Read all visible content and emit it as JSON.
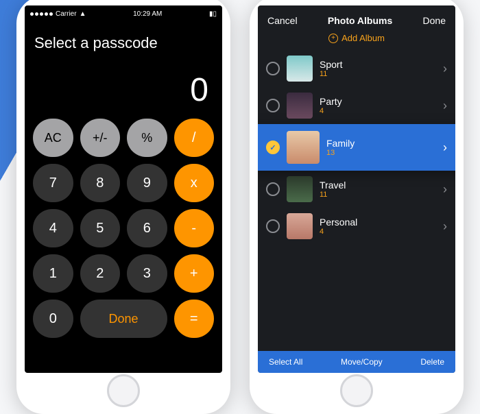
{
  "left": {
    "status_bar": {
      "carrier": "Carrier",
      "time": "10:29 AM"
    },
    "title": "Select a passcode",
    "display": "0",
    "keys": {
      "ac": "AC",
      "pm": "+/-",
      "pct": "%",
      "div": "/",
      "k7": "7",
      "k8": "8",
      "k9": "9",
      "mul": "x",
      "k4": "4",
      "k5": "5",
      "k6": "6",
      "sub": "-",
      "k1": "1",
      "k2": "2",
      "k3": "3",
      "add": "+",
      "k0": "0",
      "done": "Done",
      "eq": "="
    }
  },
  "right": {
    "nav": {
      "cancel": "Cancel",
      "title": "Photo Albums",
      "done": "Done"
    },
    "add_label": "Add Album",
    "albums": [
      {
        "name": "Sport",
        "count": "11",
        "selected": false
      },
      {
        "name": "Party",
        "count": "4",
        "selected": false
      },
      {
        "name": "Family",
        "count": "13",
        "selected": true
      },
      {
        "name": "Travel",
        "count": "11",
        "selected": false
      },
      {
        "name": "Personal",
        "count": "4",
        "selected": false
      }
    ],
    "toolbar": {
      "select_all": "Select All",
      "move_copy": "Move/Copy",
      "delete": "Delete"
    }
  }
}
